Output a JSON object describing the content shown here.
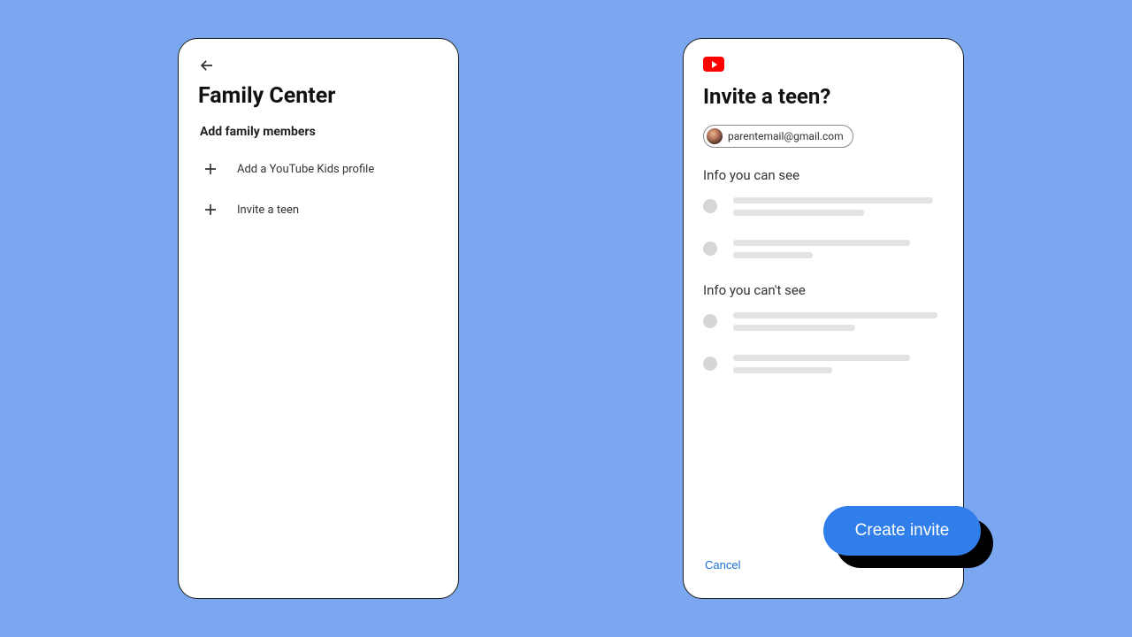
{
  "left": {
    "title": "Family Center",
    "section_label": "Add family members",
    "rows": [
      {
        "label": "Add a YouTube Kids profile"
      },
      {
        "label": "Invite a teen"
      }
    ]
  },
  "right": {
    "title": "Invite a teen?",
    "email": "parentemail@gmail.com",
    "section_can": "Info you can see",
    "section_cant": "Info you can't see",
    "cancel_label": "Cancel",
    "create_label": "Create invite"
  }
}
